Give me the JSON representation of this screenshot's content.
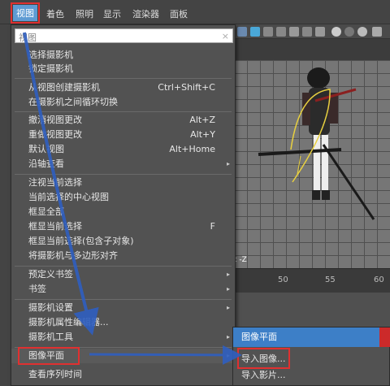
{
  "menubar": {
    "items": [
      {
        "label": "视图",
        "active": true
      },
      {
        "label": "着色"
      },
      {
        "label": "照明"
      },
      {
        "label": "显示"
      },
      {
        "label": "渲染器"
      },
      {
        "label": "面板"
      }
    ]
  },
  "menu": {
    "search_value": "视图",
    "search_clear": "×",
    "items": [
      {
        "label": "选择摄影机"
      },
      {
        "label": "锁定摄影机"
      },
      {
        "label": "从视图创建摄影机",
        "shortcut": "Ctrl+Shift+C"
      },
      {
        "label": "在摄影机之间循环切换"
      },
      {
        "label": "撤消视图更改",
        "shortcut": "Alt+Z"
      },
      {
        "label": "重做视图更改",
        "shortcut": "Alt+Y"
      },
      {
        "label": "默认视图",
        "shortcut": "Alt+Home"
      },
      {
        "label": "沿轴查看",
        "arrow": "▸"
      },
      {
        "label": "注视当前选择"
      },
      {
        "label": "当前选择的中心视图"
      },
      {
        "label": "框显全部"
      },
      {
        "label": "框显当前选择",
        "shortcut": "F"
      },
      {
        "label": "框显当前选择(包含子对象)"
      },
      {
        "label": "将摄影机与多边形对齐"
      },
      {
        "label": "预定义书签",
        "arrow": "▸"
      },
      {
        "label": "书签",
        "arrow": "▸"
      },
      {
        "label": "摄影机设置",
        "arrow": "▸"
      },
      {
        "label": "摄影机属性编辑器..."
      },
      {
        "label": "摄影机工具",
        "arrow": "▸"
      },
      {
        "label": "图像平面",
        "arrow": "▸"
      },
      {
        "label": "查看序列时间"
      }
    ]
  },
  "submenu": {
    "title": "图像平面",
    "items": [
      {
        "label": "导入图像..."
      },
      {
        "label": "导入影片..."
      }
    ]
  },
  "viewport": {
    "label": "t -Z"
  },
  "timeline": {
    "ticks": [
      "50",
      "55",
      "60"
    ]
  },
  "colors": {
    "highlight": "#3d7fc7",
    "annotation": "#e03030",
    "arrow": "#2f5fc0"
  }
}
